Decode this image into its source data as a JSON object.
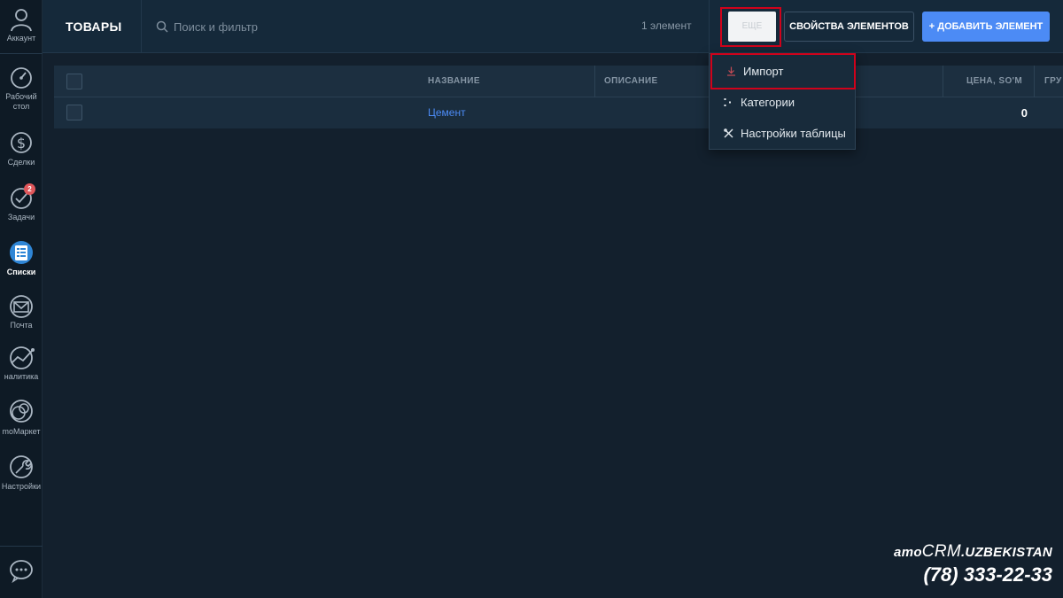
{
  "sidebar": {
    "account": {
      "label": "Аккаунт",
      "icon": "user-avatar-icon"
    },
    "items": [
      {
        "label": "Рабочий\nстол",
        "icon": "dashboard-gauge-icon"
      },
      {
        "label": "Сделки",
        "icon": "dollar-icon"
      },
      {
        "label": "Задачи",
        "icon": "check-circle-icon",
        "badge": "2"
      },
      {
        "label": "Списки",
        "icon": "lists-icon",
        "active": true
      },
      {
        "label": "Почта",
        "icon": "mail-icon"
      },
      {
        "label": "налитика",
        "icon": "analytics-icon"
      },
      {
        "label": "moМаркет",
        "icon": "market-icon"
      },
      {
        "label": "Настройки",
        "icon": "settings-wrench-icon"
      }
    ],
    "chat_icon": "chat-bubble-icon"
  },
  "header": {
    "title": "ТОВАРЫ",
    "search_placeholder": "Поиск и фильтр",
    "count": "1 элемент",
    "more_label": "ЕЩЕ",
    "props_button": "СВОЙСТВА ЭЛЕМЕНТОВ",
    "add_button": "+ ДОБАВИТЬ ЭЛЕМЕНТ"
  },
  "table": {
    "columns": [
      "НАЗВАНИЕ",
      "ОПИСАНИЕ",
      "ЦЕНА, SO'M",
      "ГРУ"
    ],
    "rows": [
      {
        "name": "Цемент",
        "description": "",
        "price": "0"
      }
    ]
  },
  "dropdown": {
    "items": [
      {
        "label": "Импорт",
        "icon": "download-icon"
      },
      {
        "label": "Категории",
        "icon": "categories-icon"
      },
      {
        "label": "Настройки таблицы",
        "icon": "tools-icon"
      }
    ]
  },
  "watermark": {
    "brand_amo": "amo",
    "brand_crm": "CRM",
    "brand_suffix": ".UZBEKISTAN",
    "phone": "(78) 333-22-33"
  },
  "colors": {
    "background": "#13202d",
    "sidebar": "#0e1a25",
    "accent_blue": "#4c8bf5",
    "highlight_red": "#d0021b",
    "badge_red": "#e0575b"
  }
}
